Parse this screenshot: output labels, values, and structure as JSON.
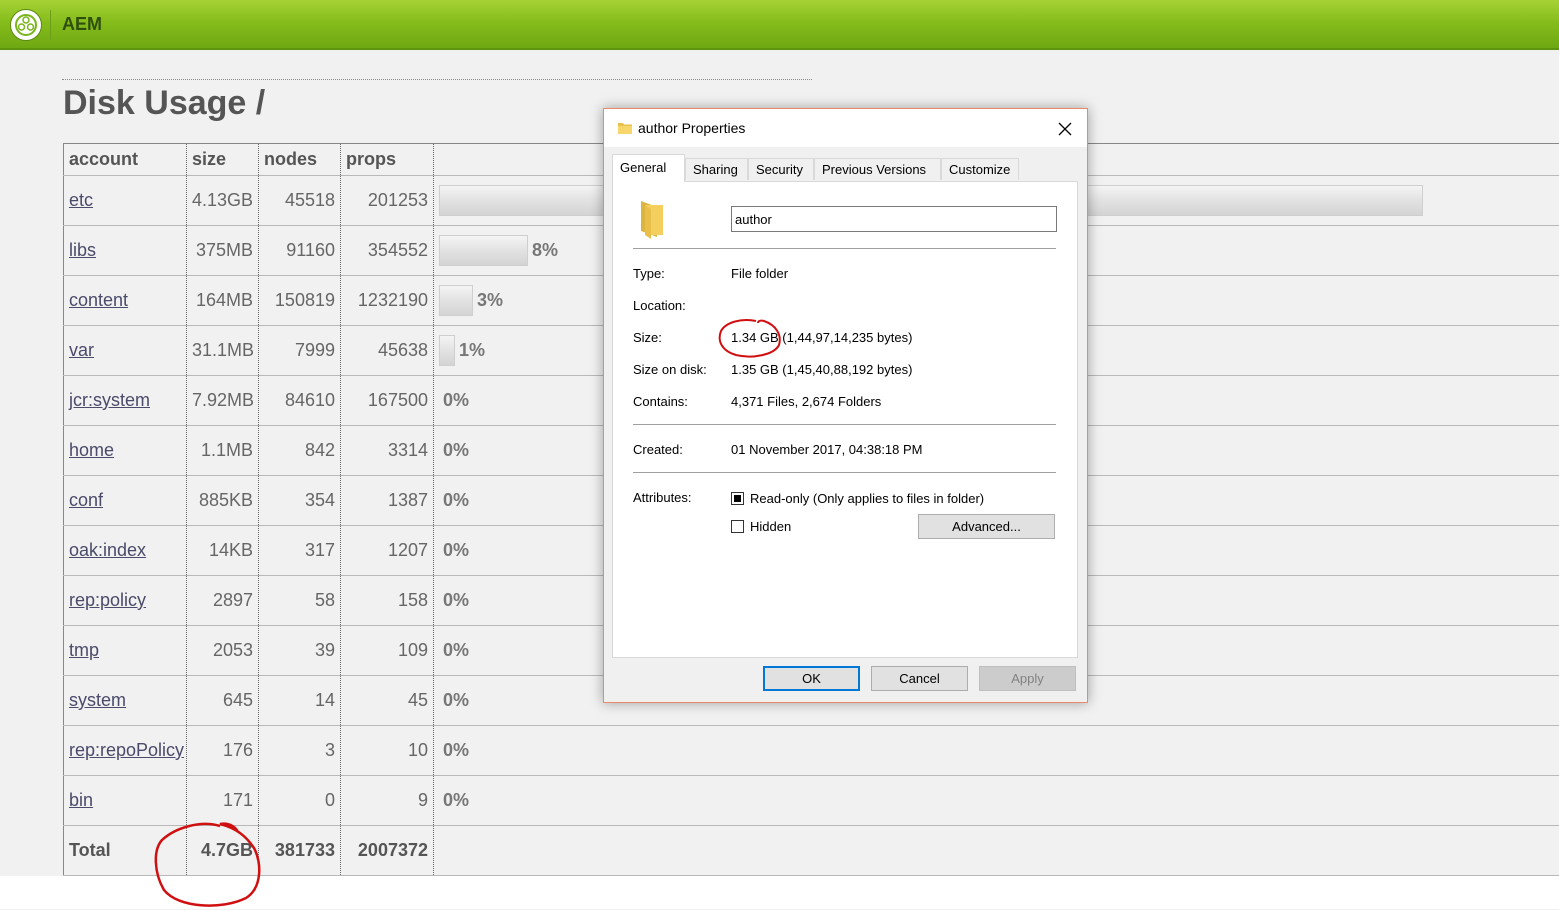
{
  "app": {
    "title": "AEM"
  },
  "page": {
    "title": "Disk Usage /"
  },
  "table": {
    "headers": [
      "account",
      "size",
      "nodes",
      "props"
    ],
    "rows": [
      {
        "account": "etc",
        "size": "4.13GB",
        "nodes": "45518",
        "props": "201253",
        "percent_label": "",
        "bar_fraction": 0.88
      },
      {
        "account": "libs",
        "size": "375MB",
        "nodes": "91160",
        "props": "354552",
        "percent_label": "8%",
        "bar_fraction": 0.08
      },
      {
        "account": "content",
        "size": "164MB",
        "nodes": "150819",
        "props": "1232190",
        "percent_label": "3%",
        "bar_fraction": 0.03
      },
      {
        "account": "var",
        "size": "31.1MB",
        "nodes": "7999",
        "props": "45638",
        "percent_label": "1%",
        "bar_fraction": 0.01
      },
      {
        "account": "jcr:system",
        "size": "7.92MB",
        "nodes": "84610",
        "props": "167500",
        "percent_label": "0%",
        "bar_fraction": 0
      },
      {
        "account": "home",
        "size": "1.1MB",
        "nodes": "842",
        "props": "3314",
        "percent_label": "0%",
        "bar_fraction": 0
      },
      {
        "account": "conf",
        "size": "885KB",
        "nodes": "354",
        "props": "1387",
        "percent_label": "0%",
        "bar_fraction": 0
      },
      {
        "account": "oak:index",
        "size": "14KB",
        "nodes": "317",
        "props": "1207",
        "percent_label": "0%",
        "bar_fraction": 0
      },
      {
        "account": "rep:policy",
        "size": "2897",
        "nodes": "58",
        "props": "158",
        "percent_label": "0%",
        "bar_fraction": 0
      },
      {
        "account": "tmp",
        "size": "2053",
        "nodes": "39",
        "props": "109",
        "percent_label": "0%",
        "bar_fraction": 0
      },
      {
        "account": "system",
        "size": "645",
        "nodes": "14",
        "props": "45",
        "percent_label": "0%",
        "bar_fraction": 0
      },
      {
        "account": "rep:repoPolicy",
        "size": "176",
        "nodes": "3",
        "props": "10",
        "percent_label": "0%",
        "bar_fraction": 0
      },
      {
        "account": "bin",
        "size": "171",
        "nodes": "0",
        "props": "9",
        "percent_label": "0%",
        "bar_fraction": 0
      }
    ],
    "total": {
      "label": "Total",
      "size": "4.7GB",
      "nodes": "381733",
      "props": "2007372"
    }
  },
  "dialog": {
    "title": "author Properties",
    "tabs": [
      "General",
      "Sharing",
      "Security",
      "Previous Versions",
      "Customize"
    ],
    "active_tab": "General",
    "name_value": "author",
    "properties": {
      "type_label": "Type:",
      "type_value": "File folder",
      "location_label": "Location:",
      "location_value": "",
      "size_label": "Size:",
      "size_value": "1.34 GB (1,44,97,14,235 bytes)",
      "size_on_disk_label": "Size on disk:",
      "size_on_disk_value": "1.35 GB (1,45,40,88,192 bytes)",
      "contains_label": "Contains:",
      "contains_value": "4,371 Files, 2,674 Folders",
      "created_label": "Created:",
      "created_value": "01 November 2017, 04:38:18 PM",
      "attributes_label": "Attributes:"
    },
    "readonly_label": "Read-only (Only applies to files in folder)",
    "readonly_state": "indeterminate",
    "hidden_label": "Hidden",
    "hidden_checked": false,
    "advanced_label": "Advanced...",
    "ok_label": "OK",
    "cancel_label": "Cancel",
    "apply_label": "Apply"
  },
  "colors": {
    "topbar": "#86bd1c",
    "annotation": "#d01010",
    "dialog_border": "#e88a6a",
    "ok_focus": "#0078d7"
  }
}
